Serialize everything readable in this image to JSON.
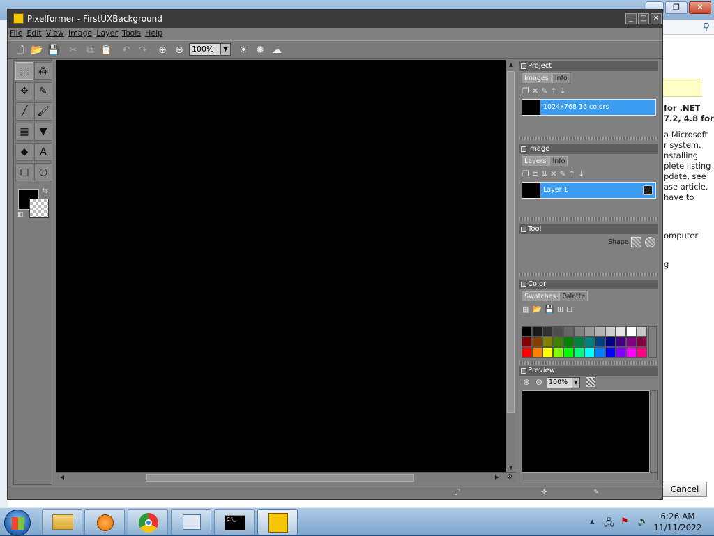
{
  "background_window": {
    "search_icon": "search-icon",
    "text_lines": [
      "for .NET",
      "7.2, 4.8 for",
      "",
      "a Microsoft",
      "r system.",
      "nstalling",
      "plete listing",
      "pdate, see",
      "ase article.",
      "have to",
      "",
      "",
      "omputer",
      "",
      "",
      "g"
    ],
    "cancel_label": "Cancel"
  },
  "app": {
    "title": "Pixelformer - FirstUXBackground",
    "menu": [
      "File",
      "Edit",
      "View",
      "Image",
      "Layer",
      "Tools",
      "Help"
    ],
    "zoom": "100%"
  },
  "panels": {
    "project": {
      "title": "Project",
      "tabs": [
        "Images",
        "Info"
      ],
      "item": "1024x768 16 colors"
    },
    "image": {
      "title": "Image",
      "tabs": [
        "Layers",
        "Info"
      ],
      "layer": "Layer 1"
    },
    "tool": {
      "title": "Tool",
      "shape_label": "Shape:"
    },
    "color": {
      "title": "Color",
      "tabs": [
        "Swatches",
        "Palette"
      ],
      "swatches": [
        "#000000",
        "#1a1a1a",
        "#333333",
        "#4d4d4d",
        "#666666",
        "#808080",
        "#999999",
        "#b3b3b3",
        "#cccccc",
        "#e6e6e6",
        "#ffffff",
        "#c8c8c8",
        "#800000",
        "#804000",
        "#808000",
        "#408000",
        "#008000",
        "#008040",
        "#008080",
        "#004080",
        "#000080",
        "#400080",
        "#800080",
        "#800040",
        "#ff0000",
        "#ff8000",
        "#ffff00",
        "#80ff00",
        "#00ff00",
        "#00ff80",
        "#00ffff",
        "#0080ff",
        "#0000ff",
        "#8000ff",
        "#ff00ff",
        "#ff0080"
      ]
    },
    "preview": {
      "title": "Preview",
      "zoom": "100%"
    }
  },
  "taskbar": {
    "time": "6:26 AM",
    "date": "11/11/2022"
  }
}
